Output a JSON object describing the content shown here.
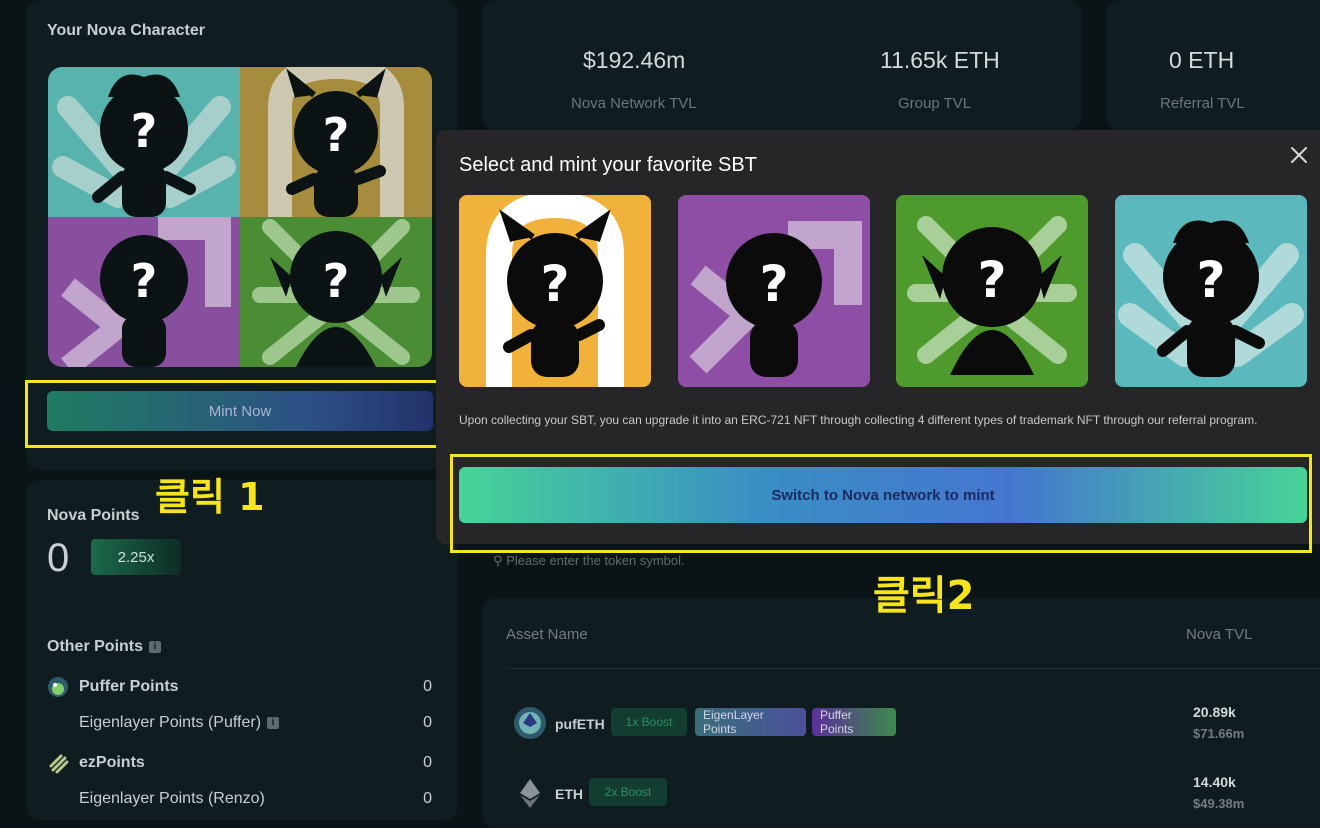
{
  "left_panel": {
    "title": "Your Nova Character",
    "mint_button": "Mint Now",
    "nova_points_label": "Nova Points",
    "nova_points_value": "0",
    "multiplier": "2.25x",
    "other_points_title": "Other Points",
    "other_points": [
      {
        "name": "Puffer Points",
        "value": "0"
      },
      {
        "name": "Eigenlayer Points (Puffer)",
        "value": "0"
      },
      {
        "name": "ezPoints",
        "value": "0"
      },
      {
        "name": "Eigenlayer Points (Renzo)",
        "value": "0"
      }
    ]
  },
  "stats": [
    {
      "value": "$192.46m",
      "label": "Nova Network TVL"
    },
    {
      "value": "11.65k ETH",
      "label": "Group TVL"
    },
    {
      "value": "0 ETH",
      "label": "Referral TVL"
    }
  ],
  "modal": {
    "title": "Select and mint your favorite SBT",
    "note": "Upon collecting your SBT, you can upgrade it into an ERC-721 NFT through collecting 4 different types of trademark NFT through our referral program.",
    "button": "Switch to Nova network to mint"
  },
  "search": {
    "placeholder": "Please enter the token symbol."
  },
  "assets": {
    "headers": {
      "name": "Asset Name",
      "tvl": "Nova TVL"
    },
    "rows": [
      {
        "symbol": "pufETH",
        "boost": "1x Boost",
        "tags": [
          "EigenLayer Points",
          "Puffer Points"
        ],
        "tvl": "20.89k",
        "tvl_usd": "$71.66m"
      },
      {
        "symbol": "ETH",
        "boost": "2x Boost",
        "tags": [],
        "tvl": "14.40k",
        "tvl_usd": "$49.38m"
      }
    ]
  },
  "annotations": {
    "click1": "클릭 1",
    "click2": "클릭2"
  },
  "colors": {
    "highlight": "#f7e51c",
    "accent_green": "#47d497",
    "accent_blue": "#4476cf"
  }
}
